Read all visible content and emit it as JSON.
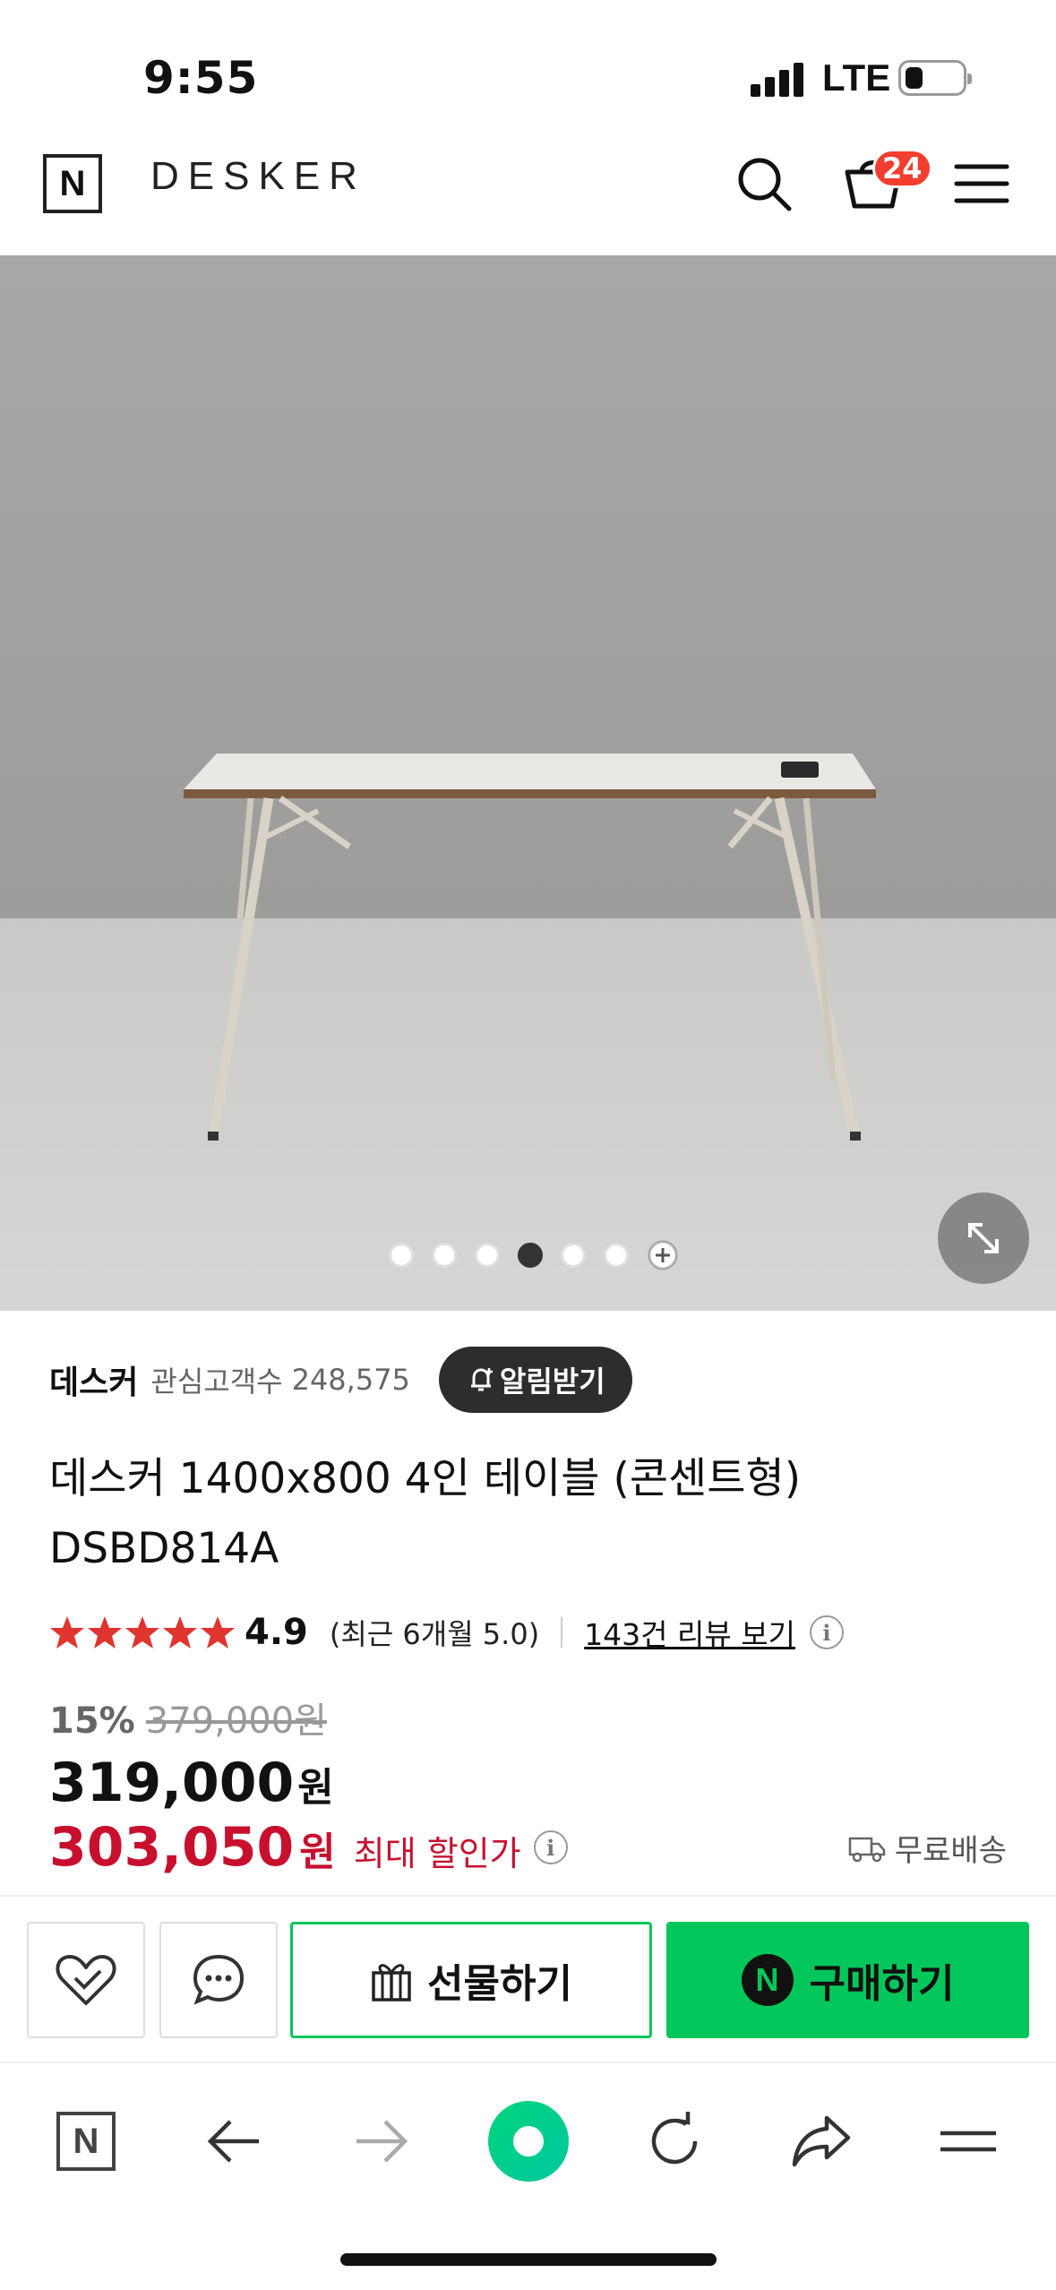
{
  "status_bar": {
    "time": "9:55",
    "network": "LTE",
    "battery_level": 0.3
  },
  "header": {
    "logo": "N",
    "brand": "DESKER",
    "cart_count": "24"
  },
  "gallery": {
    "total_images": 6,
    "active_index": 3
  },
  "seller": {
    "name": "데스커",
    "fans_label": "관심고객수",
    "fans_count": "248,575",
    "alert_button": "알림받기"
  },
  "product": {
    "title": "데스커 1400x800 4인 테이블 (콘센트형) DSBD814A"
  },
  "rating": {
    "stars": 5,
    "score": "4.9",
    "recent": "(최근 6개월 5.0)",
    "review_link": "143건 리뷰 보기"
  },
  "price": {
    "discount_rate": "15%",
    "original": "379,000원",
    "sale": "319,000",
    "currency": "원",
    "max_discount": "303,050",
    "max_label": "최대 할인가",
    "shipping": "무료배송"
  },
  "actions": {
    "gift": "선물하기",
    "buy": "구매하기",
    "buy_logo": "N"
  },
  "browser": {
    "home_logo": "N"
  },
  "colors": {
    "accent_green": "#03c75a",
    "sale_red": "#c8102e",
    "star_red": "#e0342f",
    "badge_red": "#f23d2f"
  }
}
